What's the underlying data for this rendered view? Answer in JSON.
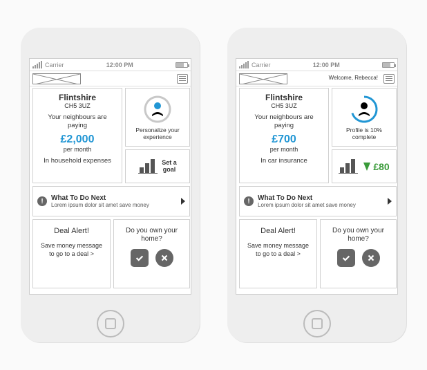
{
  "status": {
    "carrier": "Carrier",
    "time": "12:00 PM"
  },
  "phones": [
    {
      "welcome": "",
      "main": {
        "area": "Flintshire",
        "postcode": "CH5 3UZ",
        "desc": "Your neighbours are paying",
        "amount": "£2,000",
        "period": "per month",
        "category": "In household expenses"
      },
      "profile": {
        "label": "Personalize your experience",
        "arc_pct": 100,
        "arc_color": "#c8c8c8",
        "head_color": "#2196d4"
      },
      "goal": {
        "type": "set",
        "label": "Set a goal"
      },
      "next": {
        "title": "What To Do Next",
        "sub": "Lorem ipsum dolor sit amet save money"
      },
      "deal": {
        "title": "Deal Alert!",
        "msg": "Save money message to go to a deal  >"
      },
      "question": {
        "q": "Do you own your home?"
      }
    },
    {
      "welcome": "Welcome, Rebecca!",
      "main": {
        "area": "Flintshire",
        "postcode": "CH5 3UZ",
        "desc": "Your neighbours are paying",
        "amount": "£700",
        "period": "per month",
        "category": "In car insurance"
      },
      "profile": {
        "label": "Profile is 10% complete",
        "arc_pct": 70,
        "arc_color": "#2196d4",
        "head_color": "#000"
      },
      "goal": {
        "type": "savings",
        "savings": "£80"
      },
      "next": {
        "title": "What To Do Next",
        "sub": "Lorem ipsum dolor sit amet save money"
      },
      "deal": {
        "title": "Deal Alert!",
        "msg": "Save money message to go to a deal  >"
      },
      "question": {
        "q": "Do you own your home?"
      }
    }
  ]
}
